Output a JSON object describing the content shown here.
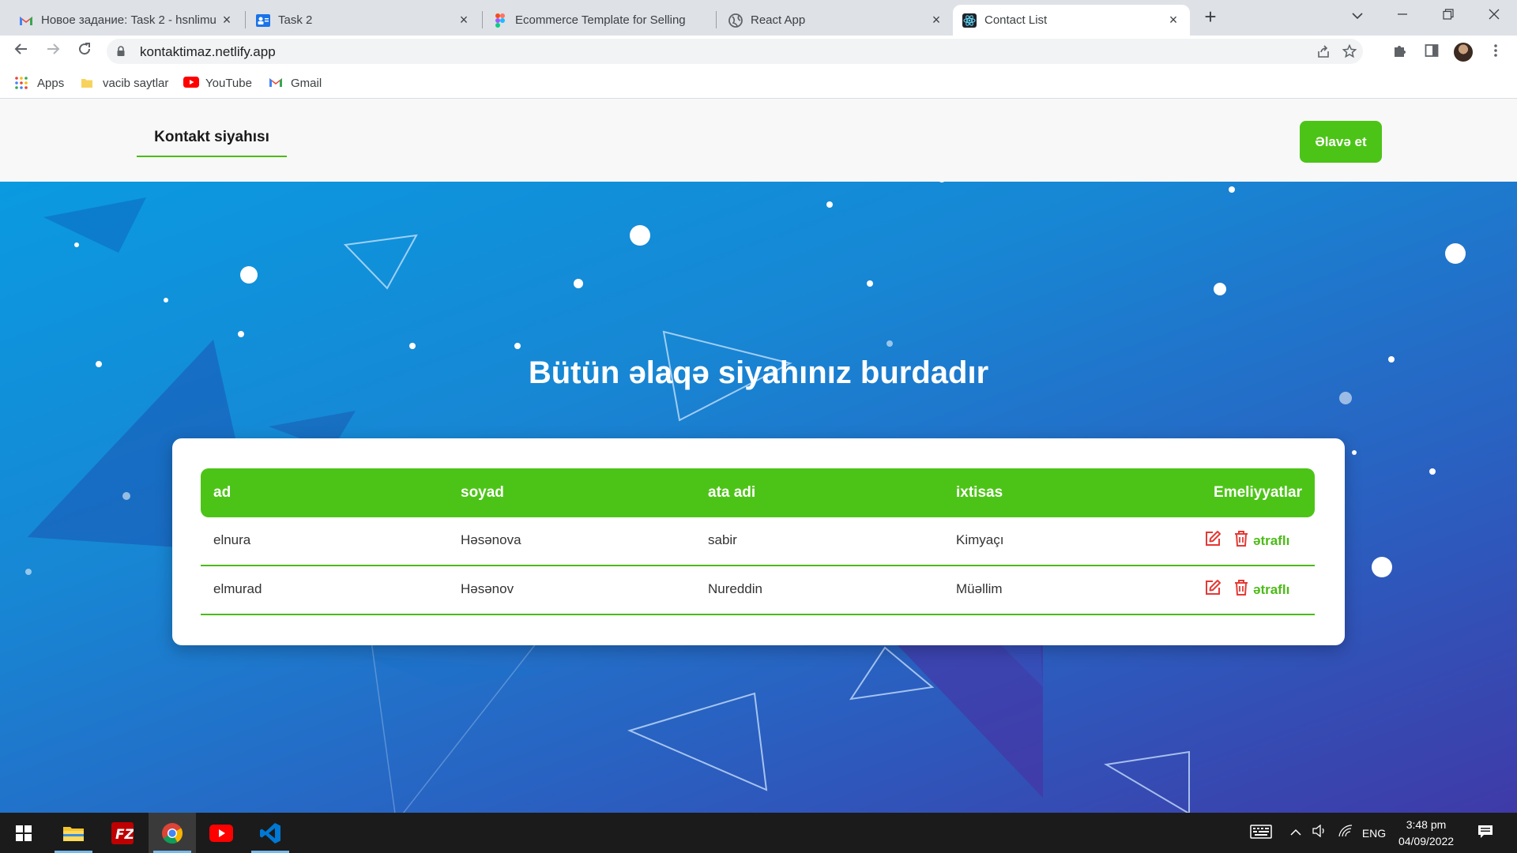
{
  "browser": {
    "tabs": [
      {
        "title": "Новое задание: Task 2 - hsnlimu",
        "icon": "gmail-icon"
      },
      {
        "title": "Task 2",
        "icon": "classroom-icon"
      },
      {
        "title": "Ecommerce Template for Selling",
        "icon": "figma-icon"
      },
      {
        "title": "React App",
        "icon": "globe-icon"
      },
      {
        "title": "Contact List",
        "icon": "react-icon"
      }
    ],
    "url": "kontaktimaz.netlify.app",
    "bookmarks": [
      {
        "label": "Apps",
        "icon": "apps-grid-icon"
      },
      {
        "label": "vacib saytlar",
        "icon": "folder-icon"
      },
      {
        "label": "YouTube",
        "icon": "youtube-icon"
      },
      {
        "label": "Gmail",
        "icon": "gmail-icon"
      }
    ]
  },
  "site": {
    "brand": "Kontakt siyahısı",
    "add_button": "Əlavə et",
    "hero_title": "Bütün əlaqə siyahınız burdadır",
    "table": {
      "headers": [
        "ad",
        "soyad",
        "ata adi",
        "ixtisas",
        "Emeliyyatlar"
      ],
      "rows": [
        {
          "ad": "elnura",
          "soyad": "Həsənova",
          "ata_adi": "sabir",
          "ixtisas": "Kimyaçı",
          "more": "ətraflı"
        },
        {
          "ad": "elmurad",
          "soyad": "Həsənov",
          "ata_adi": "Nureddin",
          "ixtisas": "Müəllim",
          "more": "ətraflı"
        }
      ]
    },
    "colors": {
      "accent": "#4cc417",
      "danger": "#e53935",
      "hero_start": "#0a9ae0",
      "hero_end": "#3f3aa8"
    }
  },
  "taskbar": {
    "apps": [
      "windows-start-icon",
      "file-explorer-icon",
      "filezilla-icon",
      "chrome-icon",
      "youtube-icon",
      "vscode-icon"
    ],
    "language": "ENG",
    "time": "3:48 pm",
    "date": "04/09/2022"
  }
}
